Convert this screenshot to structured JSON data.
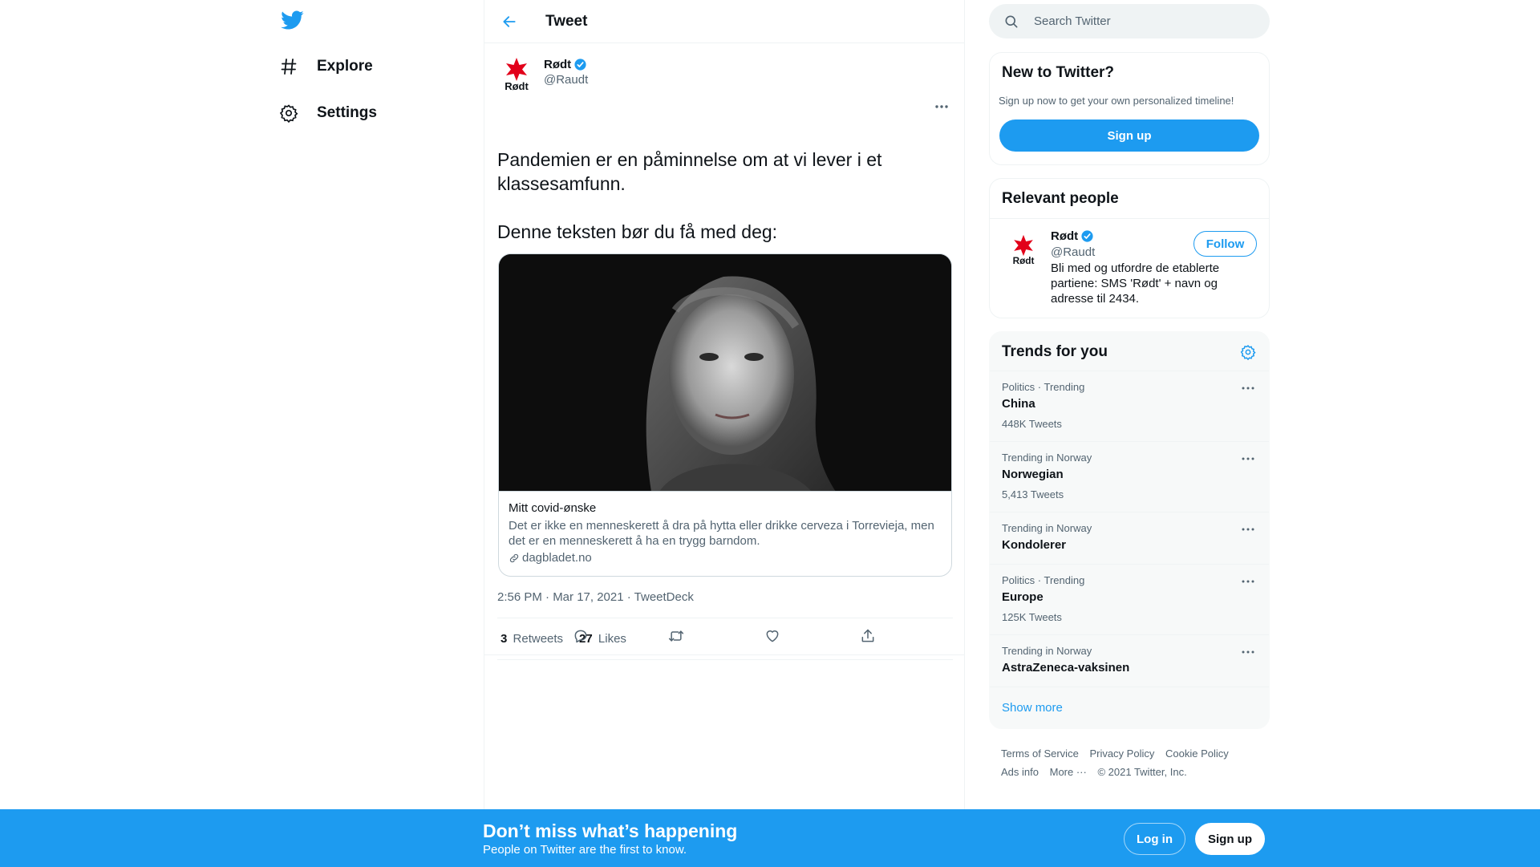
{
  "nav": {
    "items": [
      {
        "label": "Explore",
        "icon": "hashtag-icon"
      },
      {
        "label": "Settings",
        "icon": "gear-icon"
      }
    ]
  },
  "header": {
    "title": "Tweet"
  },
  "tweet": {
    "author_name": "Rødt",
    "author_handle": "@Raudt",
    "text_lines": [
      "Pandemien er en påminnelse om at vi lever i et klassesamfunn.",
      "Denne teksten bør du få med deg:"
    ],
    "card": {
      "title": "Mitt covid-ønske",
      "description": "Det er ikke en menneskerett å dra på hytta eller drikke cerveza i Torrevieja, men det er en menneskerett å ha en trygg barndom.",
      "domain": "dagbladet.no"
    },
    "timestamp": "2:56 PM · Mar 17, 2021",
    "separator": " · ",
    "source": "TweetDeck",
    "retweets_count": "3",
    "retweets_label": "Retweets",
    "likes_count": "27",
    "likes_label": "Likes"
  },
  "search": {
    "placeholder": "Search Twitter"
  },
  "new_to_twitter": {
    "title": "New to Twitter?",
    "subtitle": "Sign up now to get your own personalized timeline!",
    "button": "Sign up"
  },
  "relevant_people": {
    "title": "Relevant people",
    "person": {
      "name": "Rødt",
      "handle": "@Raudt",
      "bio": "Bli med og utfordre de etablerte partiene: SMS 'Rødt' + navn og adresse til 2434.",
      "follow_label": "Follow"
    }
  },
  "trends": {
    "title": "Trends for you",
    "items": [
      {
        "context": "Politics · Trending",
        "name": "China",
        "count": "448K Tweets"
      },
      {
        "context": "Trending in Norway",
        "name": "Norwegian",
        "count": "5,413 Tweets"
      },
      {
        "context": "Trending in Norway",
        "name": "Kondolerer",
        "count": ""
      },
      {
        "context": "Politics · Trending",
        "name": "Europe",
        "count": "125K Tweets"
      },
      {
        "context": "Trending in Norway",
        "name": "AstraZeneca-vaksinen",
        "count": ""
      }
    ],
    "show_more": "Show more"
  },
  "footer": {
    "links": [
      "Terms of Service",
      "Privacy Policy",
      "Cookie Policy",
      "Ads info",
      "More ···",
      "© 2021 Twitter, Inc."
    ]
  },
  "bottom_bar": {
    "title": "Don’t miss what’s happening",
    "subtitle": "People on Twitter are the first to know.",
    "login": "Log in",
    "signup": "Sign up"
  },
  "colors": {
    "brand": "#1d9bf0",
    "text": "#0f1419",
    "secondary": "#536471",
    "logo_red": "#e2001a"
  }
}
